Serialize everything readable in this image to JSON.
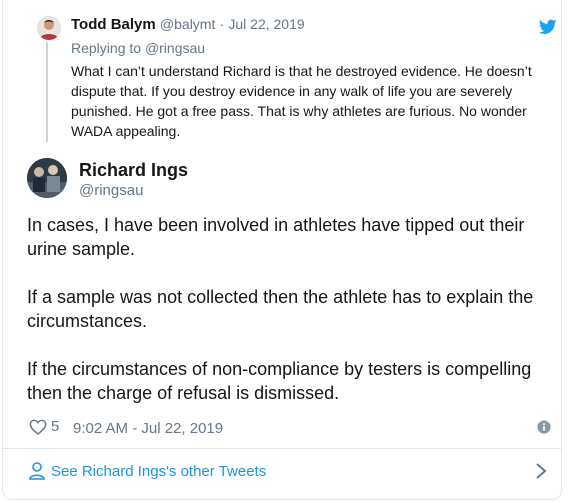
{
  "parent_tweet": {
    "name": "Todd Balym",
    "handle": "@balymt",
    "separator": "·",
    "date": "Jul 22, 2019",
    "replying_prefix": "Replying to",
    "replying_to": "@ringsau",
    "text": "What I can’t understand Richard is that he destroyed evidence. He doesn’t dispute that. If you destroy evidence in any walk of life you are severely punished. He got a free pass. That is why athletes are furious. No wonder WADA appealing."
  },
  "main_tweet": {
    "name": "Richard Ings",
    "handle": "@ringsau",
    "paragraphs": [
      "In cases, I have been involved in athletes have tipped out their urine sample.",
      "If a sample was not collected then the athlete has to explain the circumstances.",
      "If the circumstances of non-compliance by testers is compelling then the charge of refusal is dismissed."
    ],
    "like_count": "5",
    "timestamp": "9:02 AM - Jul 22, 2019"
  },
  "footer": {
    "see_more": "See Richard Ings's other Tweets"
  },
  "colors": {
    "twitter_blue": "#1da1f2",
    "link_blue": "#1b95e0",
    "muted": "#657786",
    "border": "#e1e8ed"
  },
  "icons": {
    "brand": "twitter-bird-icon",
    "like": "heart-outline-icon",
    "info": "info-icon",
    "person": "person-icon",
    "chevron": "chevron-right-icon"
  }
}
